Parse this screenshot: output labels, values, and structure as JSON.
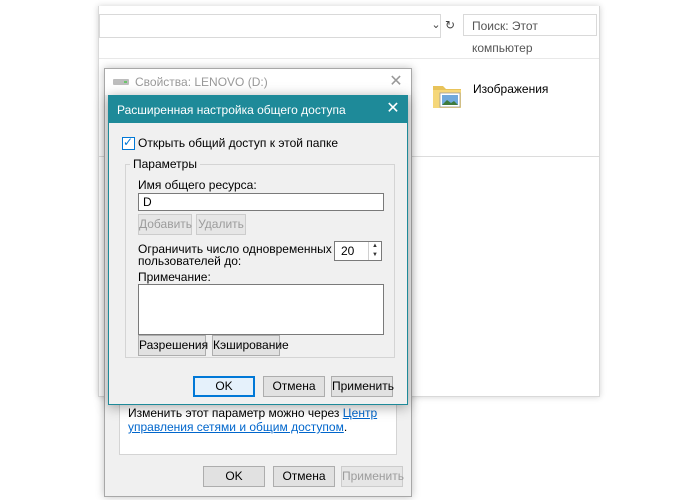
{
  "explorer": {
    "search_placeholder": "Поиск: Этот компьютер",
    "folder_label": "Изображения"
  },
  "props_dialog": {
    "title": "Свойства: LENOVO (D:)",
    "info_text": "Изменить этот параметр можно через ",
    "info_link": "Центр управления сетями и общим доступом",
    "info_end": ".",
    "ok": "OK",
    "cancel": "Отмена",
    "apply": "Применить"
  },
  "advanced_dialog": {
    "title": "Расширенная настройка общего доступа",
    "share_checkbox_label": "Открыть общий доступ к этой папке",
    "share_checked": true,
    "group_title": "Параметры",
    "share_name_label": "Имя общего ресурса:",
    "share_name_value": "D",
    "add_button": "Добавить",
    "remove_button": "Удалить",
    "limit_label_line1": "Ограничить число одновременных",
    "limit_label_line2": "пользователей до:",
    "limit_value": "20",
    "comment_label": "Примечание:",
    "permissions_button": "Разрешения",
    "caching_button": "Кэширование",
    "ok": "OK",
    "cancel": "Отмена",
    "apply": "Применить"
  },
  "colors": {
    "titlebar_accent": "#1e8a99",
    "link": "#0066cc",
    "checkbox": "#0078d7"
  },
  "icons": [
    "chevron-down-icon",
    "refresh-icon",
    "pictures-folder-icon",
    "close-icon",
    "drive-icon",
    "checkmark-icon",
    "spin-up-icon",
    "spin-down-icon"
  ]
}
